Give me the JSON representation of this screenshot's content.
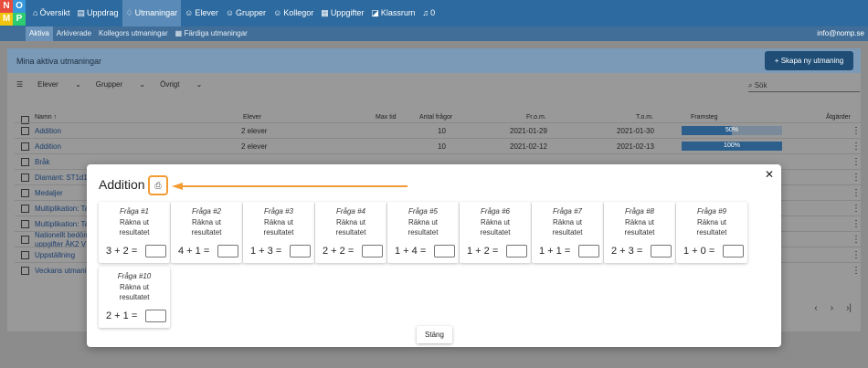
{
  "logo": {
    "letters": [
      "N",
      "O",
      "M",
      "P"
    ],
    "colors": [
      "#e74c3c",
      "#3498db",
      "#f1c40f",
      "#2ecc71"
    ]
  },
  "nav": [
    {
      "icon": "home-icon",
      "glyph": "⌂",
      "label": "Översikt"
    },
    {
      "icon": "book-icon",
      "glyph": "▤",
      "label": "Uppdrag"
    },
    {
      "icon": "trophy-icon",
      "glyph": "♢",
      "label": "Utmaningar",
      "active": true
    },
    {
      "icon": "user-icon",
      "glyph": "☺",
      "label": "Elever"
    },
    {
      "icon": "group-icon",
      "glyph": "☺",
      "label": "Grupper"
    },
    {
      "icon": "colleagues-icon",
      "glyph": "☺",
      "label": "Kollegor"
    },
    {
      "icon": "table-icon",
      "glyph": "▦",
      "label": "Uppgifter"
    },
    {
      "icon": "classroom-icon",
      "glyph": "◪",
      "label": "Klassrum"
    },
    {
      "icon": "bell-icon",
      "glyph": "♫",
      "label": "0"
    }
  ],
  "subnav": [
    {
      "label": "Aktiva",
      "active": true
    },
    {
      "label": "Arkiverade"
    },
    {
      "label": "Kollegors utmaningar"
    },
    {
      "label": "Färdiga utmaningar",
      "icon": "▦"
    }
  ],
  "account": "info@nomp.se",
  "panel": {
    "title": "Mina aktiva utmaningar",
    "create_button": "+ Skapa ny utmaning",
    "filters": [
      "Elever",
      "Grupper",
      "Övrigt"
    ],
    "search_placeholder": "Sök"
  },
  "table": {
    "headers": {
      "name": "Namn ↑",
      "students": "Elever",
      "maxtime": "Max tid",
      "questions": "Antal frågor",
      "from": "Fr.o.m.",
      "to": "T.o.m.",
      "progress": "Framsteg",
      "actions": "Åtgärder"
    },
    "rows": [
      {
        "name": "Addition",
        "students": "2 elever",
        "questions": "10",
        "from": "2021-01-29",
        "to": "2021-01-30",
        "progress": 0.5,
        "progress_label": "50%"
      },
      {
        "name": "Addition",
        "students": "2 elever",
        "questions": "10",
        "from": "2021-02-12",
        "to": "2021-02-13",
        "progress": 1.0,
        "progress_label": "100%"
      },
      {
        "name": "Bråk"
      },
      {
        "name": "Diamant: ST1d1 -"
      },
      {
        "name": "Medaljer"
      },
      {
        "name": "Multiplikation: Ta"
      },
      {
        "name": "Multiplikation: Ta"
      },
      {
        "name": "Nationellt bedöm"
      },
      {
        "name": "Uppställning"
      },
      {
        "name": "Veckans utmani"
      }
    ],
    "row7_line2": "uppgifter ÅK2 V"
  },
  "pager": [
    "‹",
    "›",
    "›|"
  ],
  "modal": {
    "title": "Addition",
    "close_label": "Stäng",
    "question_text": "Räkna ut resultatet",
    "questions": [
      {
        "label": "Fråga #1",
        "a": "3",
        "b": "2"
      },
      {
        "label": "Fråga #2",
        "a": "4",
        "b": "1"
      },
      {
        "label": "Fråga #3",
        "a": "1",
        "b": "3"
      },
      {
        "label": "Fråga #4",
        "a": "2",
        "b": "2"
      },
      {
        "label": "Fråga #5",
        "a": "1",
        "b": "4"
      },
      {
        "label": "Fråga #6",
        "a": "1",
        "b": "2"
      },
      {
        "label": "Fråga #7",
        "a": "1",
        "b": "1"
      },
      {
        "label": "Fråga #8",
        "a": "2",
        "b": "3"
      },
      {
        "label": "Fråga #9",
        "a": "1",
        "b": "0"
      },
      {
        "label": "Fråga #10",
        "a": "2",
        "b": "1"
      }
    ]
  },
  "colors": {
    "accent": "#f39c34",
    "brand": "#2d6a9f"
  }
}
